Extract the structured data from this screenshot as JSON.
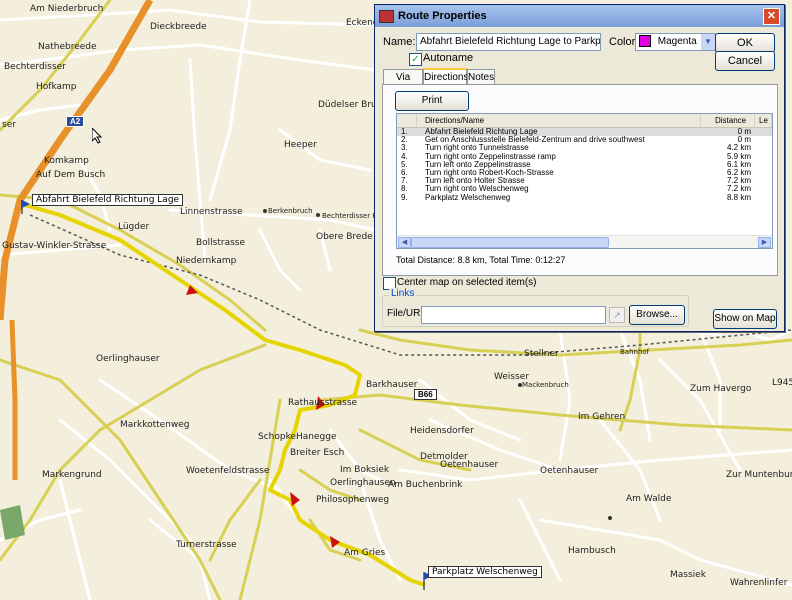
{
  "map": {
    "flags": {
      "start": "Abfahrt Bielefeld Richtung Lage",
      "end": "Parkplatz Welschenweg"
    },
    "shields": {
      "a2": "A2",
      "b66": "B66"
    },
    "labels": {
      "am_niederbruch": "Am Niederbruch",
      "nathebreede": "Nathebreede",
      "bechterdisser": "Bechterdisser",
      "hofkamp": "Hofkamp",
      "ser": "ser",
      "komkamp": "Komkamp",
      "auf_dem_busch": "Auf Dem Busch",
      "lugder": "Lügder",
      "bollstrasse": "Bollstrasse",
      "niedernkamp": "Niedernkamp",
      "gustav": "Gustav-Winkler-Strasse",
      "heeper": "Heeper",
      "obere_brede": "Obere Brede",
      "linnenstrasse": "Linnenstrasse",
      "berkenbruch": "Berkenbruch",
      "bechterdisser_heide": "Bechterdisser Heide",
      "eckend": "Eckend",
      "dieckbreede": "Dieckbreede",
      "dudde": "Düdelser Bruch",
      "oerlinghauser": "Oerlinghauser",
      "markkottenweg": "Markkottenweg",
      "woetenfeldstrasse": "Woetenfeldstrasse",
      "markengrund": "Markengrund",
      "hanegge": "Hanegge",
      "breiter_esch": "Breiter Esch",
      "im_boksiek": "Im Boksiek",
      "oerlinghausen": "Oerlinghausen",
      "am_buchenbrink": "Am Buchenbrink",
      "philosophenweg": "Philosophenweg",
      "barkhauser": "Barkhauser",
      "mackenbruch": "Mackenbruch",
      "heidensdorfer": "Heidensdorfer",
      "detmolder": "Detmolder",
      "oetenhauser": "Oetenhauser",
      "oetenhauser2": "Oetenhauser",
      "am_walde": "Am Walde",
      "weisser": "Weisser",
      "im_gehren": "Im Gehren",
      "stellner": "Stellner",
      "hambusch": "Hambusch",
      "massiek": "Massiek",
      "wahrenlinfer": "Wahrenlinfer",
      "zur_muntenburg": "Zur Muntenburg",
      "zum_havergo": "Zum Havergo",
      "turmerstrasse": "Turnerstrasse",
      "am_gries": "Am Gries",
      "rathausstrasse": "Rathausstrasse",
      "schopke": "Schopke",
      "bahnhof": "Bahnhof",
      "l945": "L945"
    }
  },
  "dialog": {
    "title": "Route Properties",
    "close_glyph": "✕",
    "name_label": "Name:",
    "name_value": "Abfahrt Bielefeld Richtung Lage to Parkplatz Welschenweg",
    "color_label": "Color:",
    "color_value": "Magenta",
    "color_swatch": "#e000e0",
    "ok": "OK",
    "cancel": "Cancel",
    "autoname_label": "Autoname",
    "autoname_checked": true,
    "tabs": [
      "Via Points",
      "Directions",
      "Notes"
    ],
    "active_tab": "Directions",
    "print_button": "Print Directions...",
    "columns": [
      "Directions/Name",
      "Distance",
      "Le"
    ],
    "directions": [
      {
        "n": "1.",
        "text": "Abfahrt Bielefeld Richtung Lage",
        "dist": "0 m"
      },
      {
        "n": "2.",
        "text": "Get on Anschlussstelle Bielefeld-Zentrum and drive southwest",
        "dist": "0 m"
      },
      {
        "n": "3.",
        "text": "Turn right onto Tunnelstrasse",
        "dist": "4.2 km"
      },
      {
        "n": "4.",
        "text": "Turn right onto Zeppelinstrasse ramp",
        "dist": "5.9 km"
      },
      {
        "n": "5.",
        "text": "Turn left onto Zeppelinstrasse",
        "dist": "6.1 km"
      },
      {
        "n": "6.",
        "text": "Turn right onto Robert-Koch-Strasse",
        "dist": "6.2 km"
      },
      {
        "n": "7.",
        "text": "Turn left onto Holter Strasse",
        "dist": "7.2 km"
      },
      {
        "n": "8.",
        "text": "Turn right onto Welschenweg",
        "dist": "7.2 km"
      },
      {
        "n": "9.",
        "text": "Parkplatz Welschenweg",
        "dist": "8.8 km"
      }
    ],
    "total": "Total Distance: 8.8 km, Total Time: 0:12:27",
    "center_map_label": "Center map on selected item(s)",
    "links_legend": "Links",
    "file_url_label": "File/URL:",
    "file_url_value": "",
    "browse": "Browse...",
    "show_on_map": "Show on Map"
  }
}
